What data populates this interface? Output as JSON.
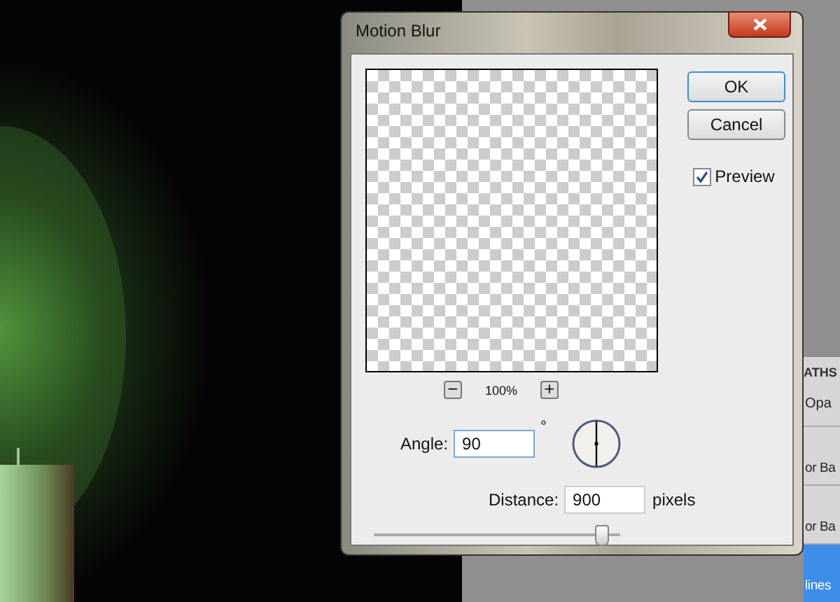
{
  "dialog": {
    "title": "Motion Blur",
    "buttons": [
      "OK",
      "Cancel"
    ],
    "preview": {
      "label": "Preview",
      "checked": true
    },
    "zoom": {
      "minus": "−",
      "plus": "+",
      "value": "100%"
    },
    "angle": {
      "label": "Angle:",
      "value": "90",
      "unit": "°"
    },
    "distance": {
      "label": "Distance:",
      "value": "900",
      "unit": "pixels",
      "level": 0.95
    }
  },
  "panels": {
    "tab": "ATHS",
    "opacity_label": "Opa",
    "layers": [
      {
        "name": "or Ba",
        "selected": false
      },
      {
        "name": "or Ba",
        "selected": false
      },
      {
        "name": "lines",
        "selected": true
      }
    ]
  }
}
